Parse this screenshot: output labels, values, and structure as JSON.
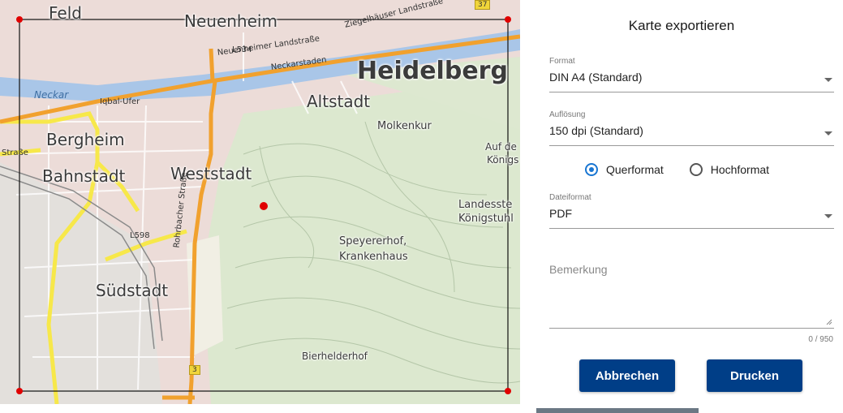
{
  "map": {
    "labels": {
      "feld": "Feld",
      "neuenheim": "Neuenheim",
      "heidelberg": "Heidelberg",
      "altstadt": "Altstadt",
      "molkenkur": "Molkenkur",
      "bergheim": "Bergheim",
      "bahnstadt": "Bahnstadt",
      "weststadt": "Weststadt",
      "auf_de": "Auf de",
      "konigs": "Königs",
      "landesste": "Landesste",
      "konigstuhl": "Königstuhl",
      "speyererhof": "Speyererhof,",
      "krankenhaus": "Krankenhaus",
      "sudstadt": "Südstadt",
      "bierhelderhof": "Bierhelderhof",
      "neckar": "Neckar",
      "iqbal_ufer": "Iqbal-Ufer",
      "strasse_left": "Straße",
      "l534": "L534",
      "neuenheimer_landstrasse": "Neuenheimer Landstraße",
      "ziegelhauser_landstr": "Ziegelhäuser Landstraße",
      "neckarstaden": "Neckarstaden",
      "rohrbacher_strasse": "Rohrbacher Straße",
      "l598": "L598",
      "route_3": "3",
      "route_37": "37"
    }
  },
  "panel": {
    "title": "Karte exportieren",
    "format": {
      "label": "Format",
      "value": "DIN A4 (Standard)"
    },
    "resolution": {
      "label": "Auflösung",
      "value": "150 dpi (Standard)"
    },
    "orientation": {
      "options": [
        {
          "label": "Querformat",
          "selected": true
        },
        {
          "label": "Hochformat",
          "selected": false
        }
      ]
    },
    "file_format": {
      "label": "Dateiformat",
      "value": "PDF"
    },
    "remark": {
      "placeholder": "Bemerkung",
      "counter": "0 / 950"
    },
    "buttons": {
      "cancel": "Abbrechen",
      "print": "Drucken"
    }
  },
  "colors": {
    "accent": "#1976d2",
    "button": "#003e87",
    "marker": "#e00000"
  }
}
